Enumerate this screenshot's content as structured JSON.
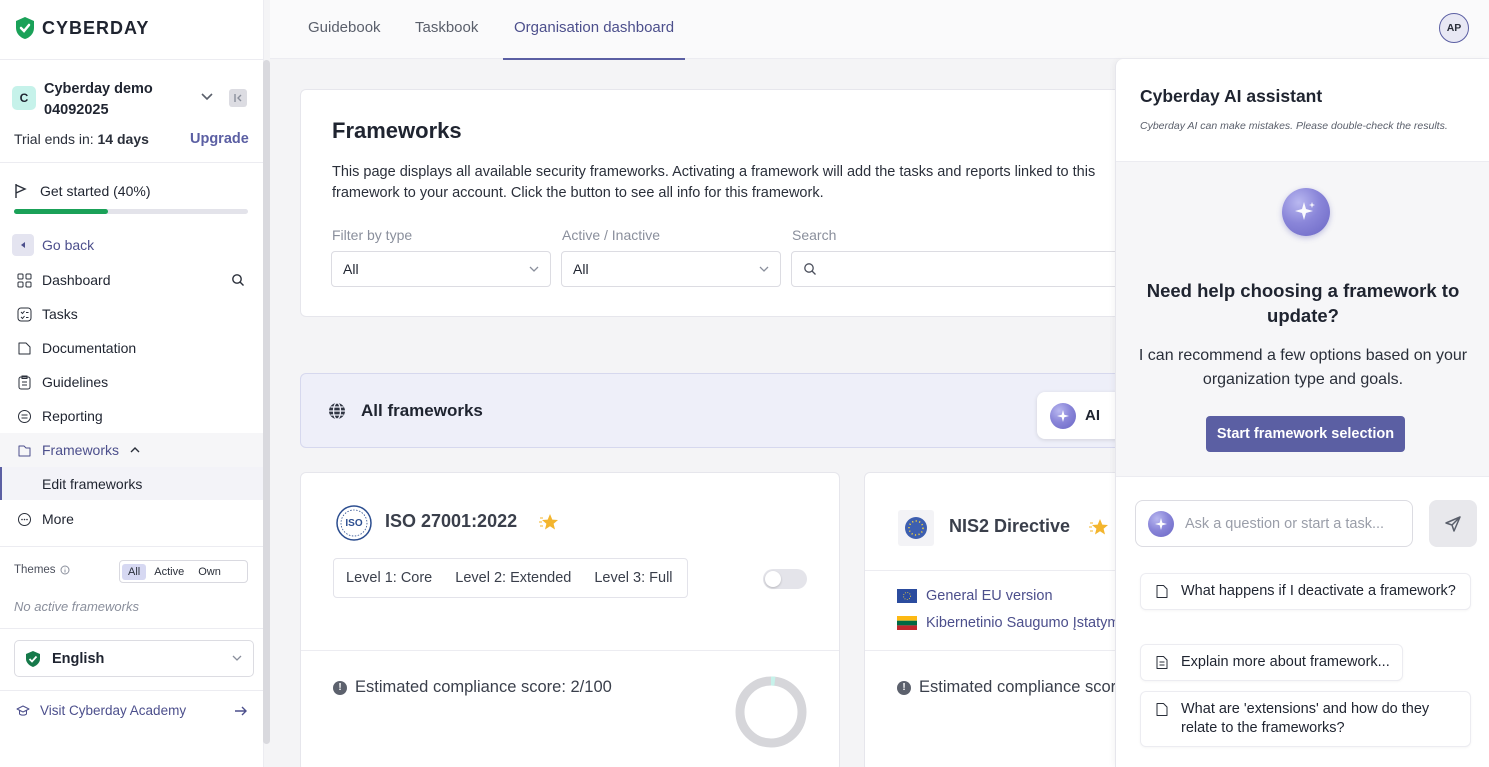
{
  "app": {
    "brand": "CYBERDAY"
  },
  "org": {
    "avatar_letter": "C",
    "name": "Cyberday demo 04092025",
    "trial_prefix": "Trial ends in:",
    "trial_days": "14 days",
    "upgrade": "Upgrade"
  },
  "onboarding": {
    "label": "Get started (40%)",
    "progress": 0.4
  },
  "nav": {
    "go_back": "Go back",
    "dashboard": "Dashboard",
    "tasks": "Tasks",
    "documentation": "Documentation",
    "guidelines": "Guidelines",
    "reporting": "Reporting",
    "frameworks": "Frameworks",
    "edit_frameworks": "Edit frameworks",
    "more": "More"
  },
  "themes": {
    "label": "Themes",
    "options": [
      "All",
      "Active",
      "Own"
    ],
    "selected": "All",
    "empty": "No active frameworks"
  },
  "language": {
    "value": "English"
  },
  "academy": {
    "label": "Visit Cyberday Academy"
  },
  "topbar": {
    "tabs": [
      "Guidebook",
      "Taskbook",
      "Organisation dashboard"
    ],
    "active_tab": "Organisation dashboard",
    "user_initials": "AP"
  },
  "frameworks_page": {
    "title": "Frameworks",
    "description": "This page displays all available security frameworks. Activating a framework will add the tasks and reports linked to this framework to your account. Click the button to see all info for this framework.",
    "filter_type_label": "Filter by type",
    "filter_type_value": "All",
    "active_label": "Active / Inactive",
    "active_value": "All",
    "search_label": "Search",
    "search_value": ""
  },
  "all_frameworks": {
    "title": "All frameworks",
    "ai_button": "AI"
  },
  "cards": [
    {
      "name": "ISO 27001:2022",
      "levels": [
        "Level 1: Core",
        "Level 2: Extended",
        "Level 3: Full"
      ],
      "active": false,
      "score_label": "Estimated compliance score: 2/100",
      "score": 2
    },
    {
      "name": "NIS2 Directive",
      "variants": [
        "General EU version",
        "Kibernetinio Saugumo Įstatymas"
      ],
      "score_label": "Estimated compliance score"
    }
  ],
  "ai_panel": {
    "title": "Cyberday AI assistant",
    "disclaimer": "Cyberday AI can make mistakes. Please double-check the results.",
    "question": "Need help choosing a framework to update?",
    "answer": "I can recommend a few options based on your organization type and goals.",
    "start_button": "Start framework selection",
    "input_placeholder": "Ask a question or start a task...",
    "suggestions": [
      "What happens if I deactivate a framework?",
      "Explain more about framework...",
      "What are 'extensions' and how do they relate to the frameworks?"
    ]
  },
  "colors": {
    "accent": "#5b5fa3",
    "progress": "#1aa158",
    "brand_green": "#1aa158"
  }
}
